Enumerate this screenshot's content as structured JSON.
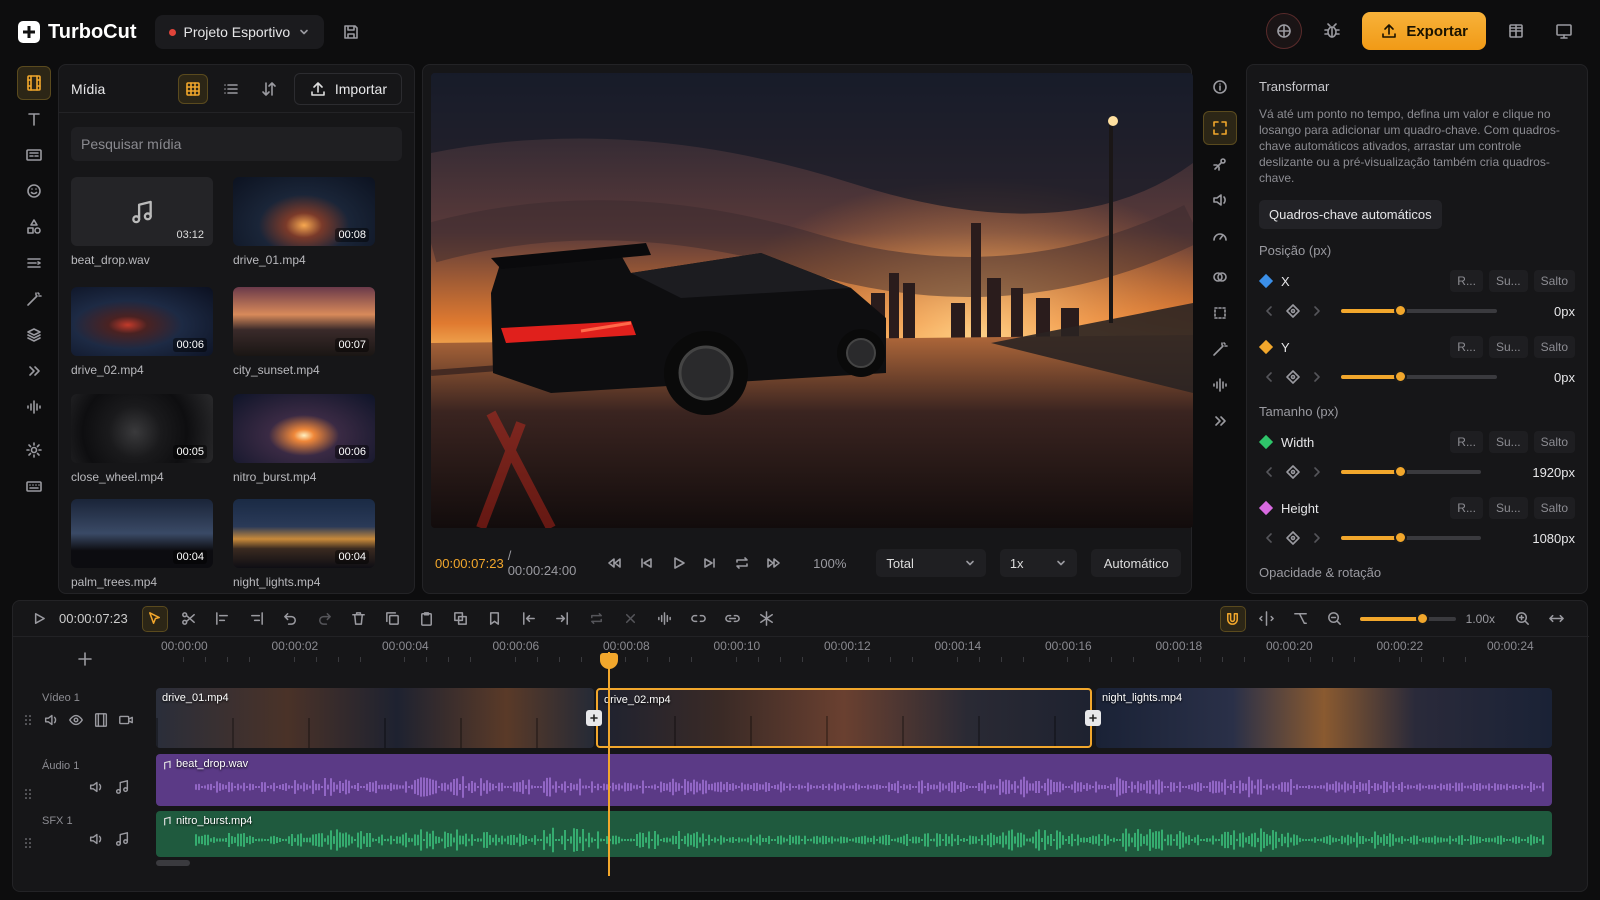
{
  "app": {
    "name": "TurboCut",
    "project": "Projeto Esportivo",
    "export_label": "Exportar"
  },
  "media": {
    "title": "Mídia",
    "import_label": "Importar",
    "search_placeholder": "Pesquisar mídia",
    "items": [
      {
        "name": "beat_drop.wav",
        "duration": "03:12",
        "kind": "audio"
      },
      {
        "name": "drive_01.mp4",
        "duration": "00:08",
        "kind": "video"
      },
      {
        "name": "drive_02.mp4",
        "duration": "00:06",
        "kind": "video"
      },
      {
        "name": "city_sunset.mp4",
        "duration": "00:07",
        "kind": "video"
      },
      {
        "name": "close_wheel.mp4",
        "duration": "00:05",
        "kind": "video"
      },
      {
        "name": "nitro_burst.mp4",
        "duration": "00:06",
        "kind": "video"
      },
      {
        "name": "palm_trees.mp4",
        "duration": "00:04",
        "kind": "video"
      },
      {
        "name": "night_lights.mp4",
        "duration": "00:04",
        "kind": "video"
      }
    ]
  },
  "preview": {
    "current_time": "00:00:07:23",
    "total_time": "/ 00:00:24:00",
    "zoom": "100%",
    "view_select": "Total",
    "speed_select": "1x",
    "quality": "Automático"
  },
  "properties": {
    "title": "Transformar",
    "description": "Vá até um ponto no tempo, defina um valor e clique no losango para adicionar um quadro-chave. Com quadros-chave automáticos ativados, arrastar um controle deslizante ou a pré-visualização também cria quadros-chave.",
    "auto_keyframes": "Quadros-chave automáticos",
    "position_section": "Posição (px)",
    "size_section": "Tamanho (px)",
    "opacity_section": "Opacidade & rotação",
    "btn_reset": "R...",
    "btn_sub": "Su...",
    "btn_jump": "Salto",
    "params": [
      {
        "name": "X",
        "value": "0px",
        "color": "#3b8fe8",
        "level": 0.38
      },
      {
        "name": "Y",
        "value": "0px",
        "color": "#f2a72c",
        "level": 0.38
      },
      {
        "name": "Width",
        "value": "1920px",
        "color": "#2fc46a",
        "level": 0.42
      },
      {
        "name": "Height",
        "value": "1080px",
        "color": "#d86ae0",
        "level": 0.42
      }
    ]
  },
  "timeline": {
    "current_time": "00:00:07:23",
    "zoom_value": "1.00x",
    "ticks": [
      "00:00:00",
      "00:00:02",
      "00:00:04",
      "00:00:06",
      "00:00:08",
      "00:00:10",
      "00:00:12",
      "00:00:14",
      "00:00:16",
      "00:00:18",
      "00:00:20",
      "00:00:22",
      "00:00:24"
    ],
    "tracks": [
      {
        "name": "Vídeo 1",
        "clips": [
          "drive_01.mp4",
          "drive_02.mp4",
          "night_lights.mp4"
        ]
      },
      {
        "name": "Áudio 1",
        "clips": [
          "beat_drop.wav"
        ]
      },
      {
        "name": "SFX 1",
        "clips": [
          "nitro_burst.mp4"
        ]
      }
    ]
  },
  "colors": {
    "accent": "#f2a72c",
    "audio_track": "#5b3a86",
    "sfx_track": "#1f5a3e"
  }
}
